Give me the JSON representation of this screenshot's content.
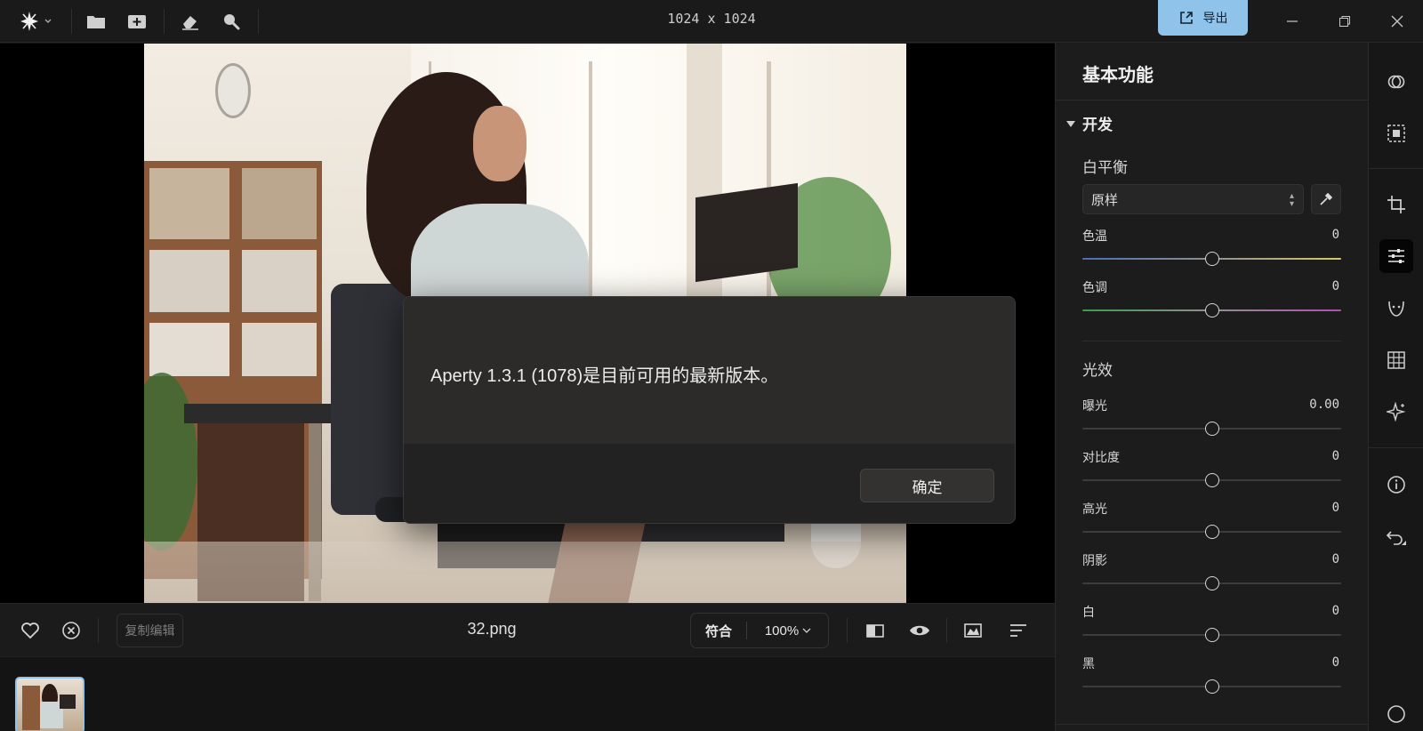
{
  "topbar": {
    "dimensions": "1024 x 1024",
    "export_label": "导出",
    "icons": [
      "app-menu-icon",
      "folder-icon",
      "add-image-icon",
      "eraser-icon",
      "brush-icon"
    ]
  },
  "dialog": {
    "message": "Aperty 1.3.1 (1078)是目前可用的最新版本。",
    "ok_label": "确定"
  },
  "bottombar": {
    "copy_edit_label": "复制编辑",
    "filename": "32.png",
    "zoom_fit_label": "符合",
    "zoom_value": "100%"
  },
  "panel": {
    "title": "基本功能",
    "section": "开发",
    "white_balance": {
      "label": "白平衡",
      "preset": "原样",
      "sliders": [
        {
          "label": "色温",
          "value": "0"
        },
        {
          "label": "色调",
          "value": "0"
        }
      ]
    },
    "light": {
      "label": "光效",
      "sliders": [
        {
          "label": "曝光",
          "value": "0.00"
        },
        {
          "label": "对比度",
          "value": "0"
        },
        {
          "label": "高光",
          "value": "0"
        },
        {
          "label": "阴影",
          "value": "0"
        },
        {
          "label": "白",
          "value": "0"
        },
        {
          "label": "黑",
          "value": "0"
        }
      ]
    }
  },
  "colors": {
    "accent": "#8fc3ea",
    "temp_track_start": "#4a6fb3",
    "temp_track_end": "#d8c86a",
    "tint_track_start": "#3f9a4f",
    "tint_track_end": "#b04fb0"
  }
}
